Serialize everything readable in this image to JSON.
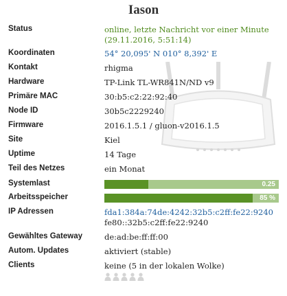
{
  "title": "Iason",
  "rows": {
    "status": {
      "label": "Status",
      "line1": "online, letzte Nachricht vor einer Minute",
      "line2": "(29.11.2016, 5:51:14)"
    },
    "koordinaten": {
      "label": "Koordinaten",
      "value": "54° 20,095' N 010° 8,392' E"
    },
    "kontakt": {
      "label": "Kontakt",
      "value": "rhigma"
    },
    "hardware": {
      "label": "Hardware",
      "value": "TP-Link TL-WR841N/ND v9"
    },
    "mac": {
      "label": "Primäre MAC",
      "value": "30:b5:c2:22:92:40"
    },
    "nodeid": {
      "label": "Node ID",
      "value": "30b5c2229240"
    },
    "firmware": {
      "label": "Firmware",
      "value": "2016.1.5.1 / gluon-v2016.1.5"
    },
    "site": {
      "label": "Site",
      "value": "Kiel"
    },
    "uptime": {
      "label": "Uptime",
      "value": "14 Tage"
    },
    "teil": {
      "label": "Teil des Netzes",
      "value": "ein Monat"
    },
    "systemlast": {
      "label": "Systemlast",
      "value": 0.25,
      "text": "0.25"
    },
    "arbeitsspeicher": {
      "label": "Arbeitsspeicher",
      "value": 0.85,
      "text": "85 %"
    },
    "ip": {
      "label": "IP Adressen",
      "ip1": "fda1:384a:74de:4242:32b5:c2ff:fe22:9240",
      "ip2": "fe80::32b5:c2ff:fe22:9240"
    },
    "gateway": {
      "label": "Gewähltes Gateway",
      "value": "de:ad:be:ff:ff:00"
    },
    "updates": {
      "label": "Autom. Updates",
      "value": "aktiviert (stable)"
    },
    "clients": {
      "label": "Clients",
      "value": "keine (5 in der lokalen Wolke)",
      "cloud_count": 5
    }
  },
  "colors": {
    "online": "#4f8a1c",
    "link": "#1f5f9e",
    "bar_fill": "#5a9226",
    "bar_bg": "#a8c98c"
  },
  "icons": {
    "background": "router-icon",
    "clients": "person-icon"
  }
}
